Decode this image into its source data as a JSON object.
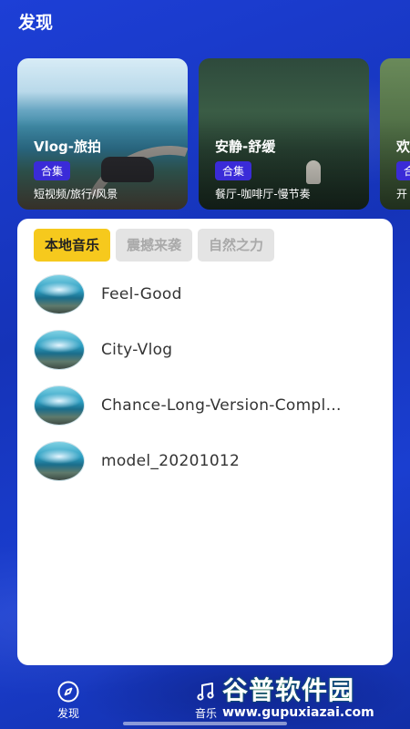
{
  "header": {
    "title": "发现"
  },
  "cards": [
    {
      "title": "Vlog-旅拍",
      "badge": "合集",
      "subtitle": "短视频/旅行/风景"
    },
    {
      "title": "安静-舒缓",
      "badge": "合集",
      "subtitle": "餐厅-咖啡厅-慢节奏"
    },
    {
      "title": "欢",
      "badge": "合",
      "subtitle": "开"
    }
  ],
  "tabs": [
    {
      "label": "本地音乐",
      "active": true
    },
    {
      "label": "震撼来袭",
      "active": false
    },
    {
      "label": "自然之力",
      "active": false
    }
  ],
  "songs": [
    {
      "name": "Feel-Good"
    },
    {
      "name": "City-Vlog"
    },
    {
      "name": "Chance-Long-Version-Compl…"
    },
    {
      "name": "model_20201012"
    }
  ],
  "bottom_nav": [
    {
      "label": "发现",
      "icon": "compass-icon"
    },
    {
      "label": "音乐",
      "icon": "music-note-icon"
    }
  ],
  "watermark": {
    "line1": "谷普软件园",
    "line2": "www.gupuxiazai.com"
  },
  "colors": {
    "accent": "#f6c91d",
    "badge": "#3a2bd8",
    "background": "#1a3ed0"
  }
}
